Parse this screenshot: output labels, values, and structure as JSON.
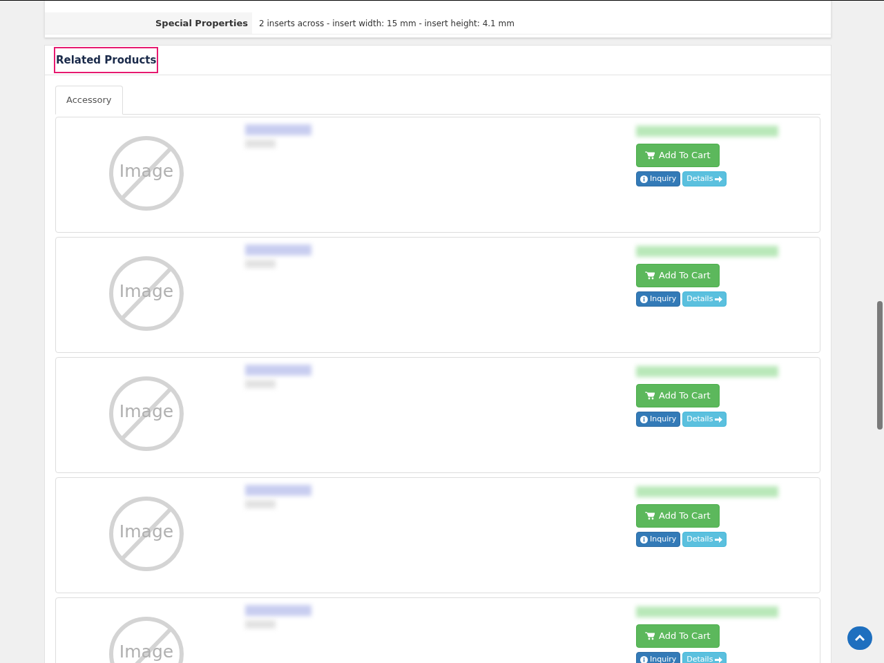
{
  "specs": [
    {
      "label": "Special Properties",
      "value": "2 inserts across - insert width: 15 mm - insert height: 4.1 mm"
    }
  ],
  "related": {
    "title": "Related Products",
    "tabs": [
      {
        "label": "Accessory",
        "selected": true
      }
    ],
    "products": [
      {
        "image_label": "Image",
        "add_label": "Add To Cart",
        "inquiry_label": "Inquiry",
        "details_label": "Details"
      },
      {
        "image_label": "Image",
        "add_label": "Add To Cart",
        "inquiry_label": "Inquiry",
        "details_label": "Details"
      },
      {
        "image_label": "Image",
        "add_label": "Add To Cart",
        "inquiry_label": "Inquiry",
        "details_label": "Details"
      },
      {
        "image_label": "Image",
        "add_label": "Add To Cart",
        "inquiry_label": "Inquiry",
        "details_label": "Details"
      },
      {
        "image_label": "Image",
        "add_label": "Add To Cart",
        "inquiry_label": "Inquiry",
        "details_label": "Details"
      }
    ]
  }
}
